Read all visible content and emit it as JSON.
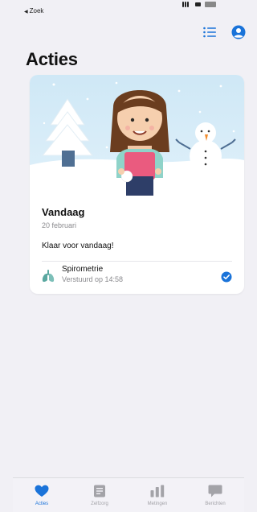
{
  "status_bar": {
    "back_label": "Zoek"
  },
  "header": {
    "title": "Acties"
  },
  "today_card": {
    "title": "Vandaag",
    "date": "20 februari",
    "message": "Klaar voor vandaag!",
    "task": {
      "name": "Spirometrie",
      "status": "Verstuurd op 14:58",
      "icon": "lungs-icon",
      "completed": true
    }
  },
  "tab_bar": {
    "tabs": [
      {
        "label": "Acties",
        "icon": "heart-icon",
        "active": true
      },
      {
        "label": "Zelfzorg",
        "icon": "document-icon",
        "active": false
      },
      {
        "label": "Metingen",
        "icon": "bar-chart-icon",
        "active": false
      },
      {
        "label": "Berichten",
        "icon": "chat-bubble-icon",
        "active": false
      }
    ]
  },
  "colors": {
    "accent": "#1a73d9",
    "background": "#f1f0f5",
    "inactive_tab": "#a3a3a8",
    "task_icon": "#5aa8a0"
  }
}
